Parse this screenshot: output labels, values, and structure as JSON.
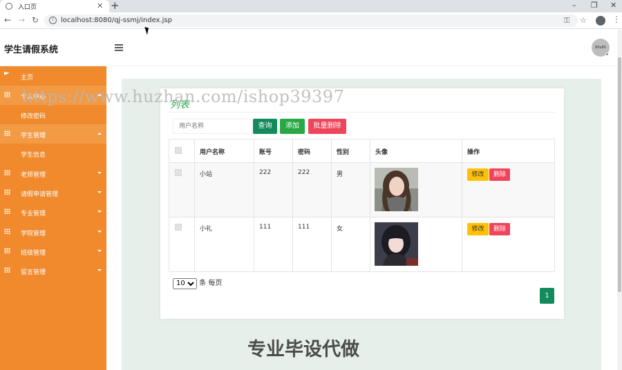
{
  "browser": {
    "tab_title": "入口页",
    "url": "localhost:8080/qj-ssmj/index.jsp"
  },
  "header": {
    "app_title": "学生请假系统",
    "avatar_text": "80x80"
  },
  "sidebar": {
    "items": [
      {
        "label": "主页"
      },
      {
        "label": "个人中心"
      },
      {
        "label": "修改密码"
      },
      {
        "label": "学生管理"
      },
      {
        "label": "学生信息"
      },
      {
        "label": "老师管理"
      },
      {
        "label": "请假申请管理"
      },
      {
        "label": "专业管理"
      },
      {
        "label": "学院管理"
      },
      {
        "label": "班级管理"
      },
      {
        "label": "留言管理"
      }
    ]
  },
  "main": {
    "card_title": "列表",
    "search_placeholder": "用户名称",
    "btn_query": "查询",
    "btn_add": "添加",
    "btn_batch_delete": "批量删除",
    "table": {
      "headers": [
        "用户名称",
        "账号",
        "密码",
        "性别",
        "头像",
        "操作"
      ],
      "rows": [
        {
          "name": "小站",
          "account": "222",
          "password": "222",
          "gender": "男",
          "edit": "修改",
          "delete": "删除"
        },
        {
          "name": "小礼",
          "account": "111",
          "password": "111",
          "gender": "女",
          "edit": "修改",
          "delete": "删除"
        }
      ]
    },
    "page_size": "10",
    "page_size_suffix": "条 每页",
    "current_page": "1"
  },
  "watermarks": {
    "url": "https://www.huzhan.com/ishop39397",
    "bottom": "专业毕设代做"
  }
}
